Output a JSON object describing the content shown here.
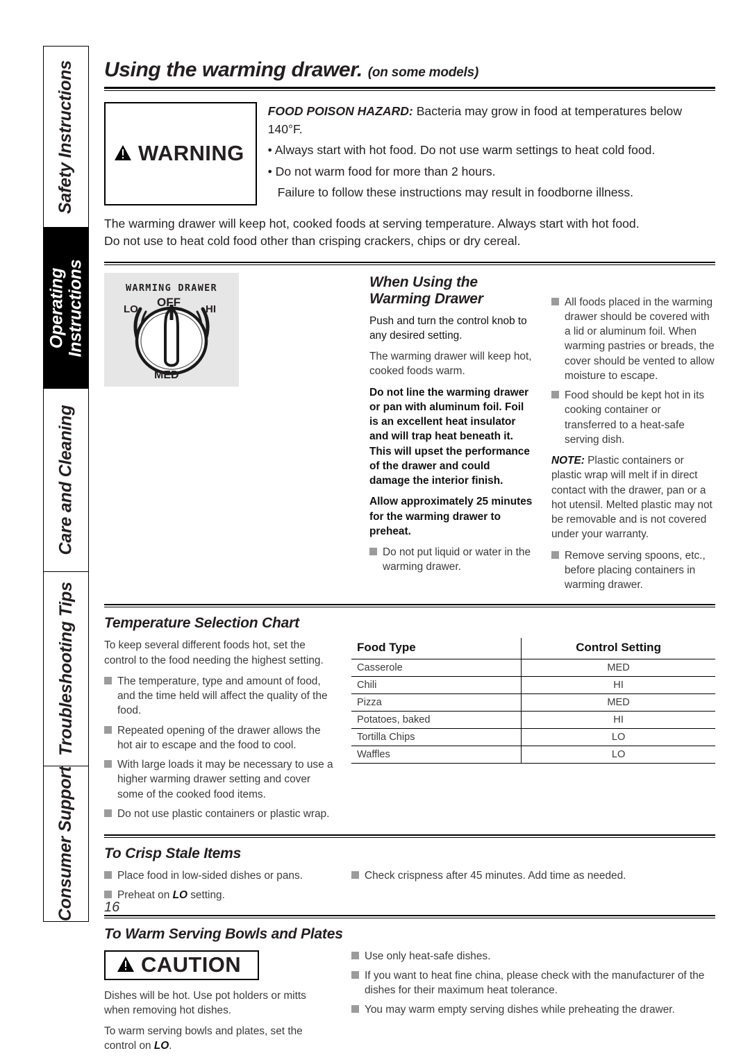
{
  "sidebar": {
    "tabs": [
      {
        "label": "Safety Instructions",
        "active": false
      },
      {
        "label": "Operating\nInstructions",
        "active": true
      },
      {
        "label": "Care and Cleaning",
        "active": false
      },
      {
        "label": "Troubleshooting Tips",
        "active": false
      },
      {
        "label": "Consumer Support",
        "active": false
      }
    ]
  },
  "header": {
    "title": "Using the warming drawer.",
    "subtitle": "(on some models)"
  },
  "warning": {
    "signal_word": "WARNING",
    "hazard_label": "FOOD POISON HAZARD:",
    "hazard_text": "Bacteria may grow in food at temperatures below 140°F.",
    "bullets": [
      "• Always start with hot food. Do not use warm settings to heat cold food.",
      "• Do not warm food for more than 2 hours."
    ],
    "failure_text": "Failure to follow these instructions may result in foodborne illness."
  },
  "intro": {
    "line1": "The warming drawer will keep hot, cooked foods at serving temperature. Always start with hot food.",
    "line2": "Do not use to heat cold food other than crisping crackers, chips or dry cereal."
  },
  "knob": {
    "caption": "WARMING DRAWER",
    "labels": {
      "off": "OFF",
      "lo": "LO",
      "hi": "HI",
      "med": "MED"
    }
  },
  "when_using": {
    "title": "When Using the Warming Drawer",
    "p1": "Push and turn the control knob to any desired setting.",
    "p2": "The warming drawer will keep hot, cooked foods warm.",
    "p3": "Do not line the warming drawer or pan with aluminum foil. Foil is an excellent heat insulator and will trap heat beneath it. This will upset the performance of the drawer and could damage the interior finish.",
    "p4": "Allow approximately 25 minutes for the warming drawer to preheat.",
    "bullet1": "Do not put liquid or water in the warming drawer.",
    "r_bullet1": "All foods placed in the warming drawer should be covered with a lid or aluminum foil. When warming pastries or breads, the cover should be vented to allow moisture to escape.",
    "r_bullet2": "Food should be kept hot in its cooking container or transferred to a heat-safe serving dish.",
    "note_label": "NOTE:",
    "note_text": "Plastic containers or plastic wrap will melt if in direct contact with the drawer, pan or a hot utensil. Melted plastic may not be removable and is not covered under your warranty.",
    "r_bullet3": "Remove serving spoons, etc., before placing containers in warming drawer."
  },
  "temperature_chart": {
    "title": "Temperature Selection Chart",
    "p1": "To keep several different foods hot, set the control to the food needing the highest setting.",
    "bullets": [
      "The temperature, type and amount of food, and the time held will affect the quality of the food.",
      "Repeated opening of the drawer allows the hot air to escape and the food to cool.",
      "With large loads it may be necessary to use a higher warming drawer setting and cover some of the cooked food items.",
      "Do not use plastic containers or plastic wrap."
    ],
    "table": {
      "headers": [
        "Food Type",
        "Control Setting"
      ],
      "rows": [
        [
          "Casserole",
          "MED"
        ],
        [
          "Chili",
          "HI"
        ],
        [
          "Pizza",
          "MED"
        ],
        [
          "Potatoes, baked",
          "HI"
        ],
        [
          "Tortilla Chips",
          "LO"
        ],
        [
          "Waffles",
          "LO"
        ]
      ]
    }
  },
  "crisp": {
    "title": "To Crisp Stale Items",
    "left_bullet1": "Place food in low-sided dishes or pans.",
    "left_bullet2_pre": "Preheat on ",
    "left_bullet2_em": "LO",
    "left_bullet2_post": " setting.",
    "right_bullet1": "Check crispness after 45 minutes. Add time as needed."
  },
  "warm_bowls": {
    "title": "To Warm Serving Bowls and Plates",
    "caution_word": "CAUTION",
    "p1": "Dishes will be hot. Use pot holders or mitts when removing hot dishes.",
    "p2_pre": "To warm serving bowls and plates, set the control on ",
    "p2_em": "LO",
    "p2_post": ".",
    "bullets": [
      "Use only heat-safe dishes.",
      "If you want to heat fine china, please check with the manufacturer of the dishes for their maximum heat tolerance.",
      "You may warm empty serving dishes while preheating the drawer."
    ]
  },
  "page_number": "16"
}
